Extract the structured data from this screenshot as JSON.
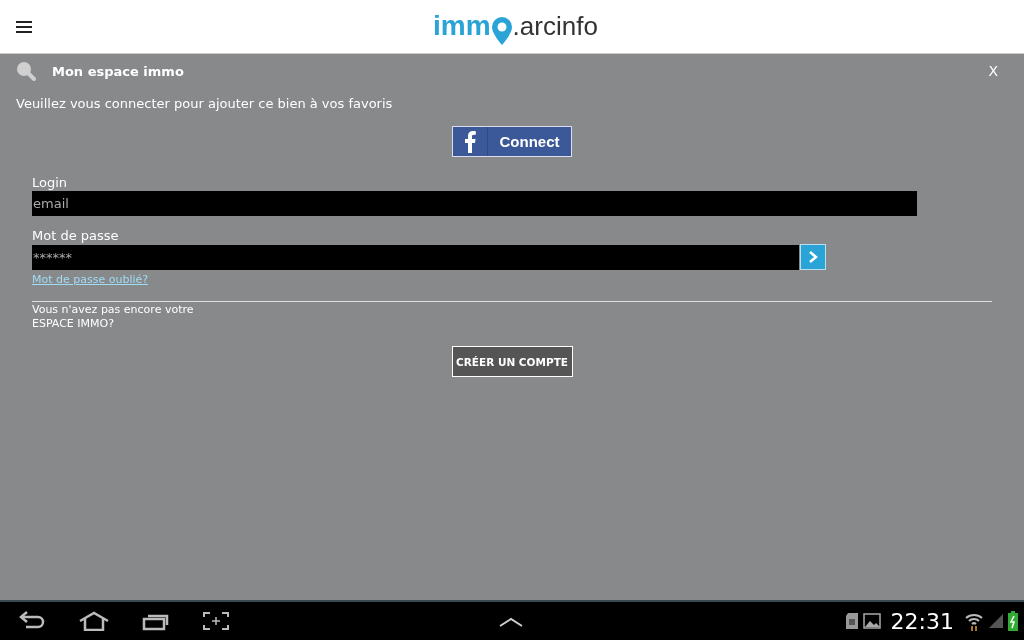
{
  "header": {
    "logo_left": "imm",
    "logo_right": ".arcinfo"
  },
  "panel": {
    "title": "Mon espace immo",
    "close": "X",
    "message": "Veuillez vous connecter pour ajouter ce bien à vos favoris",
    "facebook_button": "Connect"
  },
  "login": {
    "label": "Login",
    "placeholder": "email"
  },
  "password": {
    "label": "Mot de passe",
    "placeholder": "******",
    "forgot_link": "Mot de passe oublié?"
  },
  "signup": {
    "prompt_lines": [
      "Vous n'avez pas encore votre",
      "ESPACE IMMO?"
    ],
    "button": "CRÉER UN COMPTE"
  },
  "status_bar": {
    "time": "22:31"
  }
}
